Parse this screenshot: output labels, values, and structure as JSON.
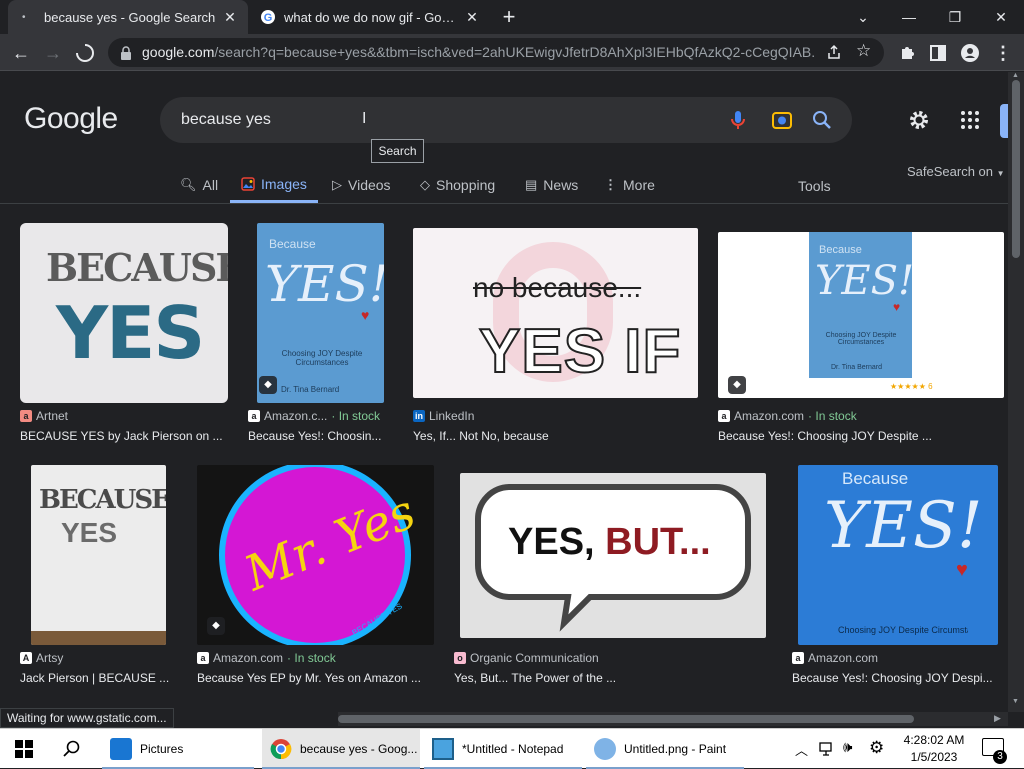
{
  "browser": {
    "tabs": [
      {
        "title": "because yes - Google Search",
        "active": true
      },
      {
        "title": "what do we do now gif - Google",
        "active": false
      }
    ],
    "url_domain": "google.com",
    "url_rest": "/search?q=because+yes&&tbm=isch&ved=2ahUKEwigvJfetrD8AhXpl3IEHbQfAzkQ2-cCegQIAB..."
  },
  "search": {
    "logo": "Google",
    "query": "because yes",
    "tooltip": "Search"
  },
  "nav": {
    "items": [
      {
        "label": "All",
        "icon": "search-icon"
      },
      {
        "label": "Images",
        "icon": "image-icon"
      },
      {
        "label": "Videos",
        "icon": "video-icon"
      },
      {
        "label": "Shopping",
        "icon": "tag-icon"
      },
      {
        "label": "News",
        "icon": "news-icon"
      },
      {
        "label": "More",
        "icon": "more-dots-icon"
      }
    ],
    "tools": "Tools",
    "safesearch": "SafeSearch on"
  },
  "results": [
    {
      "source": "Artnet",
      "stock": "",
      "caption": "BECAUSE YES by Jack Pierson on ..."
    },
    {
      "source": "Amazon.c...",
      "stock": "· In stock",
      "caption": "Because Yes!: Choosin..."
    },
    {
      "source": "LinkedIn",
      "stock": "",
      "caption": "Yes, If... Not No, because"
    },
    {
      "source": "Amazon.com",
      "stock": "· In stock",
      "caption": "Because Yes!: Choosing JOY Despite ..."
    },
    {
      "source": "Artsy",
      "stock": "",
      "caption": "Jack Pierson | BECAUSE ..."
    },
    {
      "source": "Amazon.com",
      "stock": "· In stock",
      "caption": "Because Yes EP by Mr. Yes on Amazon ..."
    },
    {
      "source": "Organic Communication",
      "stock": "",
      "caption": "Yes, But... The Power of the ..."
    },
    {
      "source": "Amazon.com",
      "stock": "",
      "caption": "Because Yes!: Choosing JOY Despi..."
    }
  ],
  "images": {
    "because": "BECAUSE",
    "yes": "YES",
    "book_because": "Because",
    "book_yes": "YES!",
    "book_subtitle": "Choosing JOY Despite Circumstances",
    "book_author": "Dr. Tina Bernard",
    "no_because": "no because...",
    "yes_if": "YES IF",
    "rating": "★★★★★ 6",
    "mr_yes": "Mr. Yes",
    "because_yes_small": "BECAUSE YES",
    "yes_but_1": "YES, ",
    "yes_but_2": "BUT..."
  },
  "status_text": "Waiting for www.gstatic.com...",
  "taskbar": {
    "items": [
      {
        "label": "Pictures"
      },
      {
        "label": "because yes - Goog..."
      },
      {
        "label": "*Untitled - Notepad"
      },
      {
        "label": "Untitled.png - Paint"
      }
    ],
    "time": "4:28:02 AM",
    "date": "1/5/2023",
    "notifications": "3"
  }
}
